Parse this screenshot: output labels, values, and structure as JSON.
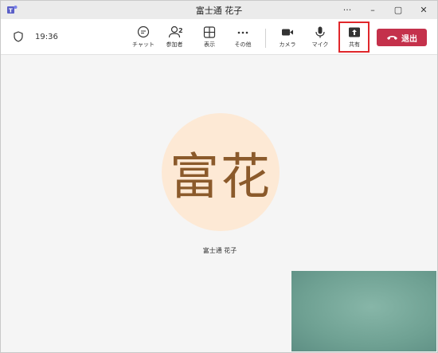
{
  "window": {
    "title": "富士通 花子",
    "controls": [
      "···",
      "–",
      "▢",
      "✕"
    ]
  },
  "toolbar": {
    "time": "19:36",
    "chat_label": "チャット",
    "people_label": "参加者",
    "people_count": "2",
    "view_label": "表示",
    "more_label": "その他",
    "camera_label": "カメラ",
    "mic_label": "マイク",
    "share_label": "共有",
    "leave_label": "退出"
  },
  "participant": {
    "avatar_text": "富花",
    "name": "富士通 花子"
  },
  "colors": {
    "leave": "#c4314b",
    "highlight": "#e0272b",
    "avatar_bg": "#fde9d5",
    "avatar_text": "#8b5a2b"
  }
}
